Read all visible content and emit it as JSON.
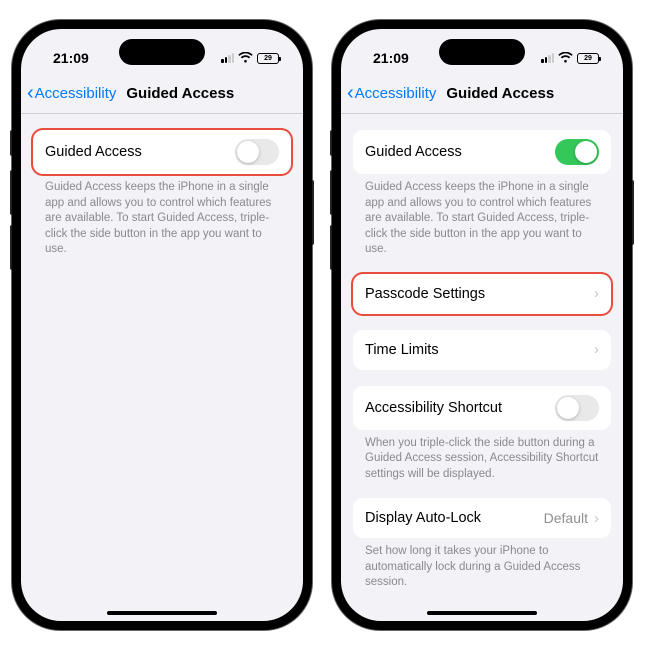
{
  "status": {
    "time": "21:09",
    "battery": "29"
  },
  "nav": {
    "back": "Accessibility",
    "title": "Guided Access"
  },
  "left": {
    "main_toggle": {
      "label": "Guided Access"
    },
    "footer": "Guided Access keeps the iPhone in a single app and allows you to control which features are available. To start Guided Access, triple-click the side button in the app you want to use."
  },
  "right": {
    "main_toggle": {
      "label": "Guided Access"
    },
    "footer1": "Guided Access keeps the iPhone in a single app and allows you to control which features are available. To start Guided Access, triple-click the side button in the app you want to use.",
    "passcode": {
      "label": "Passcode Settings"
    },
    "time_limits": {
      "label": "Time Limits"
    },
    "a11y_shortcut": {
      "label": "Accessibility Shortcut"
    },
    "footer2": "When you triple-click the side button during a Guided Access session, Accessibility Shortcut settings will be displayed.",
    "auto_lock": {
      "label": "Display Auto-Lock",
      "value": "Default"
    },
    "footer3": "Set how long it takes your iPhone to automatically lock during a Guided Access session."
  }
}
